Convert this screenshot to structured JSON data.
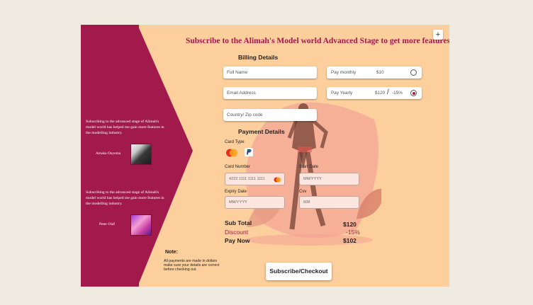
{
  "header": {
    "title": "Subscribe to the Alimah's Model world Advanced Stage to get more features",
    "plus_label": "+"
  },
  "sidebar": {
    "testimonials": [
      {
        "text": "Subscribing to the advanced stage of Alimah's model world has helped me gain more features in the modelling industry.",
        "name": "Amaka Onyema"
      },
      {
        "text": "Subscribing to the advanced stage of Alimah's model world has helped me gain more features in the modelling industry.",
        "name": "Peter Olaf"
      }
    ]
  },
  "billing": {
    "heading": "Billing Details",
    "full_name_placeholder": "Full Name",
    "email_placeholder": "Email Address",
    "country_placeholder": "Country/ Zip code",
    "monthly": {
      "label": "Pay monthly",
      "price": "$10",
      "selected": false
    },
    "yearly": {
      "label": "Pay Yearly",
      "price": "$120",
      "separator": "/",
      "discount": "-15%",
      "selected": true
    }
  },
  "payment": {
    "heading": "Payment Details",
    "card_type_label": "Card Type",
    "card_number_label": "Card Number",
    "card_number_value": "4222 1111 1111 1111",
    "start_date_label": "Start Date",
    "start_date_placeholder": "MM/YYYY",
    "expiry_label": "Expiry Date",
    "expiry_placeholder": "MM/YYYY",
    "cvv_label": "Cvv",
    "cvv_value": "608"
  },
  "summary": {
    "subtotal_label": "Sub Total",
    "subtotal_value": "$120",
    "discount_label": "Discount",
    "discount_value": "-15%",
    "paynow_label": "Pay Now",
    "paynow_value": "$102"
  },
  "note": {
    "heading": "Note:",
    "text": "All payments are made in dollars make sure your details are correct before checking out."
  },
  "checkout_label": "Subscribe/Checkout",
  "colors": {
    "background": "#efebe0",
    "panel": "#fccf9d",
    "accent": "#a21a4b",
    "blob": "#f4a396"
  }
}
